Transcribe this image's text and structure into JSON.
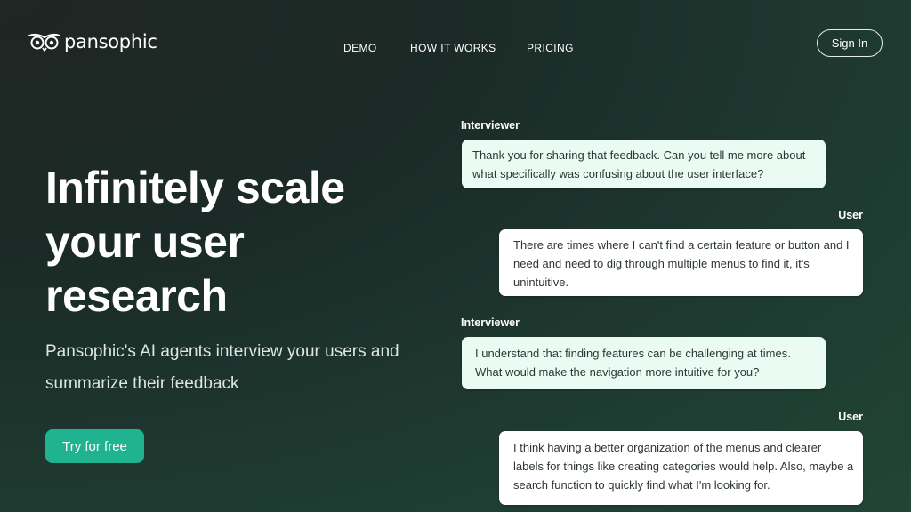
{
  "header": {
    "brand": "pansophic",
    "nav": [
      "DEMO",
      "HOW IT WORKS",
      "PRICING"
    ],
    "signin_label": "Sign In"
  },
  "hero": {
    "title": "Infinitely scale your user research",
    "subtitle": "Pansophic's AI agents interview your users and summarize their feedback",
    "cta_label": "Try for free"
  },
  "chat": [
    {
      "speaker": "Interviewer",
      "text": "Thank you for sharing that feedback. Can you tell me more about what specifically was confusing about the user interface?"
    },
    {
      "speaker": "User",
      "text": "There are times where I can't find a certain feature or button and I need and need to dig through multiple menus to find it, it's unintuitive."
    },
    {
      "speaker": "Interviewer",
      "text": "I understand that finding features can be challenging at times. What would make the navigation more intuitive for you?"
    },
    {
      "speaker": "User",
      "text": "I think having a better organization of the menus and clearer labels for things like creating categories would help. Also, maybe a search function to quickly find what I'm looking for."
    }
  ],
  "colors": {
    "accent": "#1fb48f",
    "background": "#1e3a31",
    "interviewer_bubble": "#eafbf4",
    "user_bubble": "#ffffff"
  },
  "icons": {
    "logo": "owl-eyes-icon"
  }
}
